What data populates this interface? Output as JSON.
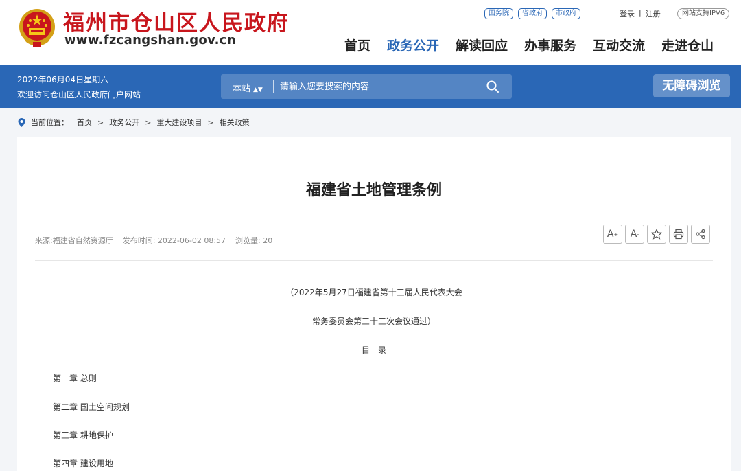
{
  "header": {
    "site_name": "福州市仓山区人民政府",
    "site_url": "www.fzcangshan.gov.cn",
    "gov_links": [
      "国务院",
      "省政府",
      "市政府"
    ],
    "login": "登录",
    "auth_sep": "|",
    "register": "注册",
    "ipv6": "网站支持IPV6",
    "nav": [
      "首页",
      "政务公开",
      "解读回应",
      "办事服务",
      "互动交流",
      "走进仓山"
    ],
    "active_nav": "政务公开"
  },
  "bar": {
    "date": "2022年06月04日星期六",
    "welcome": "欢迎访问仓山区人民政府门户网站",
    "search_scope": "本站",
    "search_placeholder": "请输入您要搜索的内容",
    "accessibility": "无障碍浏览"
  },
  "breadcrumb": {
    "label": "当前位置：",
    "items": [
      "首页",
      "政务公开",
      "重大建设项目",
      "相关政策"
    ],
    "separator": ">"
  },
  "article": {
    "title": "福建省土地管理条例",
    "source": "来源:福建省自然资源厅",
    "published": "发布时间: 2022-06-02 08:57",
    "views": "浏览量: 20",
    "tools": [
      "A",
      "+",
      "A",
      "-"
    ],
    "intro_line1": "（2022年5月27日福建省第十三届人民代表大会",
    "intro_line2": "常务委员会第三十三次会议通过）",
    "toc_heading": "目　录",
    "toc": [
      "第一章  总则",
      "第二章  国土空间规划",
      "第三章  耕地保护",
      "第四章  建设用地"
    ]
  },
  "colors": {
    "brand_blue": "#2a67b6",
    "brand_red": "#c8161d"
  },
  "icons": [
    "national-emblem-icon",
    "search-icon",
    "location-pin-icon",
    "font-increase-icon",
    "font-decrease-icon",
    "star-icon",
    "print-icon",
    "share-icon"
  ]
}
